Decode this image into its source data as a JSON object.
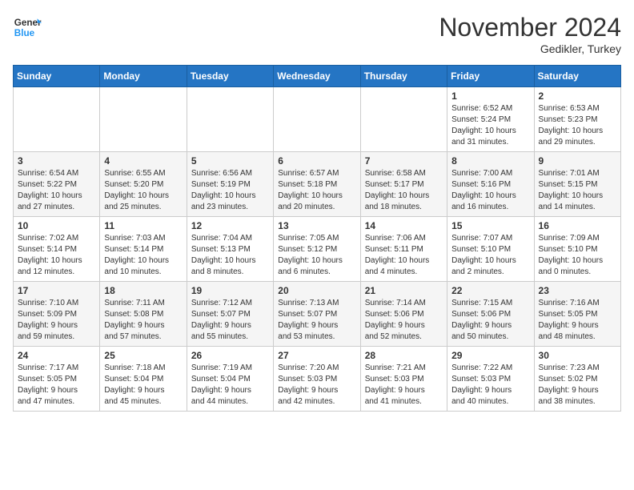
{
  "header": {
    "logo_line1": "General",
    "logo_line2": "Blue",
    "month_title": "November 2024",
    "location": "Gedikler, Turkey"
  },
  "weekdays": [
    "Sunday",
    "Monday",
    "Tuesday",
    "Wednesday",
    "Thursday",
    "Friday",
    "Saturday"
  ],
  "weeks": [
    [
      {
        "day": "",
        "info": ""
      },
      {
        "day": "",
        "info": ""
      },
      {
        "day": "",
        "info": ""
      },
      {
        "day": "",
        "info": ""
      },
      {
        "day": "",
        "info": ""
      },
      {
        "day": "1",
        "info": "Sunrise: 6:52 AM\nSunset: 5:24 PM\nDaylight: 10 hours\nand 31 minutes."
      },
      {
        "day": "2",
        "info": "Sunrise: 6:53 AM\nSunset: 5:23 PM\nDaylight: 10 hours\nand 29 minutes."
      }
    ],
    [
      {
        "day": "3",
        "info": "Sunrise: 6:54 AM\nSunset: 5:22 PM\nDaylight: 10 hours\nand 27 minutes."
      },
      {
        "day": "4",
        "info": "Sunrise: 6:55 AM\nSunset: 5:20 PM\nDaylight: 10 hours\nand 25 minutes."
      },
      {
        "day": "5",
        "info": "Sunrise: 6:56 AM\nSunset: 5:19 PM\nDaylight: 10 hours\nand 23 minutes."
      },
      {
        "day": "6",
        "info": "Sunrise: 6:57 AM\nSunset: 5:18 PM\nDaylight: 10 hours\nand 20 minutes."
      },
      {
        "day": "7",
        "info": "Sunrise: 6:58 AM\nSunset: 5:17 PM\nDaylight: 10 hours\nand 18 minutes."
      },
      {
        "day": "8",
        "info": "Sunrise: 7:00 AM\nSunset: 5:16 PM\nDaylight: 10 hours\nand 16 minutes."
      },
      {
        "day": "9",
        "info": "Sunrise: 7:01 AM\nSunset: 5:15 PM\nDaylight: 10 hours\nand 14 minutes."
      }
    ],
    [
      {
        "day": "10",
        "info": "Sunrise: 7:02 AM\nSunset: 5:14 PM\nDaylight: 10 hours\nand 12 minutes."
      },
      {
        "day": "11",
        "info": "Sunrise: 7:03 AM\nSunset: 5:14 PM\nDaylight: 10 hours\nand 10 minutes."
      },
      {
        "day": "12",
        "info": "Sunrise: 7:04 AM\nSunset: 5:13 PM\nDaylight: 10 hours\nand 8 minutes."
      },
      {
        "day": "13",
        "info": "Sunrise: 7:05 AM\nSunset: 5:12 PM\nDaylight: 10 hours\nand 6 minutes."
      },
      {
        "day": "14",
        "info": "Sunrise: 7:06 AM\nSunset: 5:11 PM\nDaylight: 10 hours\nand 4 minutes."
      },
      {
        "day": "15",
        "info": "Sunrise: 7:07 AM\nSunset: 5:10 PM\nDaylight: 10 hours\nand 2 minutes."
      },
      {
        "day": "16",
        "info": "Sunrise: 7:09 AM\nSunset: 5:10 PM\nDaylight: 10 hours\nand 0 minutes."
      }
    ],
    [
      {
        "day": "17",
        "info": "Sunrise: 7:10 AM\nSunset: 5:09 PM\nDaylight: 9 hours\nand 59 minutes."
      },
      {
        "day": "18",
        "info": "Sunrise: 7:11 AM\nSunset: 5:08 PM\nDaylight: 9 hours\nand 57 minutes."
      },
      {
        "day": "19",
        "info": "Sunrise: 7:12 AM\nSunset: 5:07 PM\nDaylight: 9 hours\nand 55 minutes."
      },
      {
        "day": "20",
        "info": "Sunrise: 7:13 AM\nSunset: 5:07 PM\nDaylight: 9 hours\nand 53 minutes."
      },
      {
        "day": "21",
        "info": "Sunrise: 7:14 AM\nSunset: 5:06 PM\nDaylight: 9 hours\nand 52 minutes."
      },
      {
        "day": "22",
        "info": "Sunrise: 7:15 AM\nSunset: 5:06 PM\nDaylight: 9 hours\nand 50 minutes."
      },
      {
        "day": "23",
        "info": "Sunrise: 7:16 AM\nSunset: 5:05 PM\nDaylight: 9 hours\nand 48 minutes."
      }
    ],
    [
      {
        "day": "24",
        "info": "Sunrise: 7:17 AM\nSunset: 5:05 PM\nDaylight: 9 hours\nand 47 minutes."
      },
      {
        "day": "25",
        "info": "Sunrise: 7:18 AM\nSunset: 5:04 PM\nDaylight: 9 hours\nand 45 minutes."
      },
      {
        "day": "26",
        "info": "Sunrise: 7:19 AM\nSunset: 5:04 PM\nDaylight: 9 hours\nand 44 minutes."
      },
      {
        "day": "27",
        "info": "Sunrise: 7:20 AM\nSunset: 5:03 PM\nDaylight: 9 hours\nand 42 minutes."
      },
      {
        "day": "28",
        "info": "Sunrise: 7:21 AM\nSunset: 5:03 PM\nDaylight: 9 hours\nand 41 minutes."
      },
      {
        "day": "29",
        "info": "Sunrise: 7:22 AM\nSunset: 5:03 PM\nDaylight: 9 hours\nand 40 minutes."
      },
      {
        "day": "30",
        "info": "Sunrise: 7:23 AM\nSunset: 5:02 PM\nDaylight: 9 hours\nand 38 minutes."
      }
    ]
  ]
}
